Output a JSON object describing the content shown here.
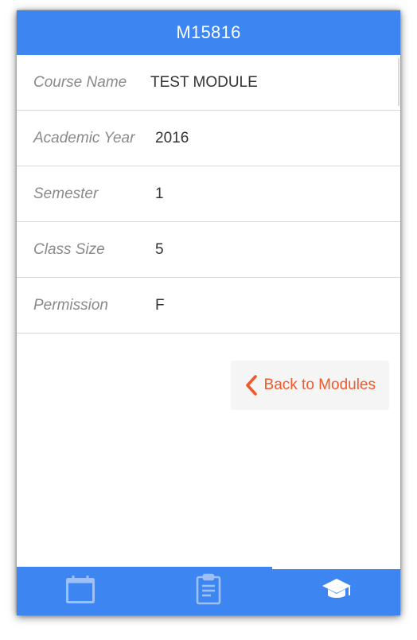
{
  "header": {
    "title": "M15816"
  },
  "details": {
    "rows": [
      {
        "label": "Course Name",
        "value": "TEST MODULE"
      },
      {
        "label": "Academic Year",
        "value": "2016"
      },
      {
        "label": "Semester",
        "value": "1"
      },
      {
        "label": "Class Size",
        "value": "5"
      },
      {
        "label": "Permission",
        "value": "F"
      }
    ]
  },
  "actions": {
    "back_label": "Back to Modules",
    "back_icon": "chevron-left-icon"
  },
  "tabbar": {
    "tabs": [
      {
        "icon": "calendar-icon",
        "active": false
      },
      {
        "icon": "clipboard-icon",
        "active": false
      },
      {
        "icon": "graduation-cap-icon",
        "active": true
      }
    ]
  },
  "colors": {
    "primary": "#3d86f2",
    "accent": "#f2592a",
    "label": "#8a8a8a",
    "value": "#333333"
  }
}
